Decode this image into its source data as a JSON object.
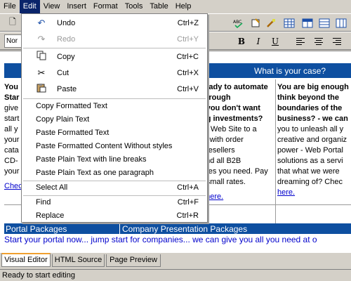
{
  "menubar": [
    "File",
    "Edit",
    "View",
    "Insert",
    "Format",
    "Tools",
    "Table",
    "Help"
  ],
  "toolbar": {
    "font_value": "Nor"
  },
  "edit_menu": {
    "group1": [
      {
        "label": "Undo",
        "shortcut": "Ctrl+Z",
        "icon": "undo-icon",
        "disabled": false
      },
      {
        "label": "Redo",
        "shortcut": "Ctrl+Y",
        "icon": "redo-icon",
        "disabled": true
      }
    ],
    "group2": [
      {
        "label": "Copy",
        "shortcut": "Ctrl+C",
        "icon": "copy-icon"
      },
      {
        "label": "Cut",
        "shortcut": "Ctrl+X",
        "icon": "cut-icon"
      },
      {
        "label": "Paste",
        "shortcut": "Ctrl+V",
        "icon": "paste-icon"
      }
    ],
    "group3": [
      "Copy Formatted Text",
      "Copy Plain Text",
      "Paste Formatted Text",
      "Paste Formatted Content Without styles",
      "Paste Plain Text with line breaks",
      "Paste Plain Text as one paragraph"
    ],
    "select_all": {
      "label": "Select All",
      "shortcut": "Ctrl+A"
    },
    "find": {
      "label": "Find",
      "shortcut": "Ctrl+F"
    },
    "replace": {
      "label": "Replace",
      "shortcut": "Ctrl+R"
    }
  },
  "document": {
    "banner_right": "What is your case?",
    "col1": {
      "lines": [
        "You",
        "Star",
        "give",
        "start",
        "all y",
        "your",
        "cata",
        "CD-",
        "your"
      ],
      "link": "Chec"
    },
    "col2": {
      "lines": [
        "ready to automate",
        "through",
        "t you don't want",
        "ng investments?",
        "ur Web Site to a",
        "al with order",
        ", resellers",
        "and all B2B",
        "ures you need. Pay",
        "r small rates."
      ],
      "link": "t here."
    },
    "col3": {
      "lines": [
        "You are big enough",
        "think beyond the",
        "boundaries of the",
        "business? - we can",
        "you to unleash all y",
        "creative and organiz",
        "power - Web Portal",
        "solutions as a servi",
        "that what we were",
        "dreaming of? Chec"
      ],
      "link": "here."
    },
    "pkg_left": "Portal Packages",
    "pkg_right": "Company Presentation Packages",
    "bottom_text": "Start your portal now... jump start for companies... we can give you all you need at o"
  },
  "tabs": [
    "Visual Editor",
    "HTML Source",
    "Page Preview"
  ],
  "status": "Ready to start editing"
}
